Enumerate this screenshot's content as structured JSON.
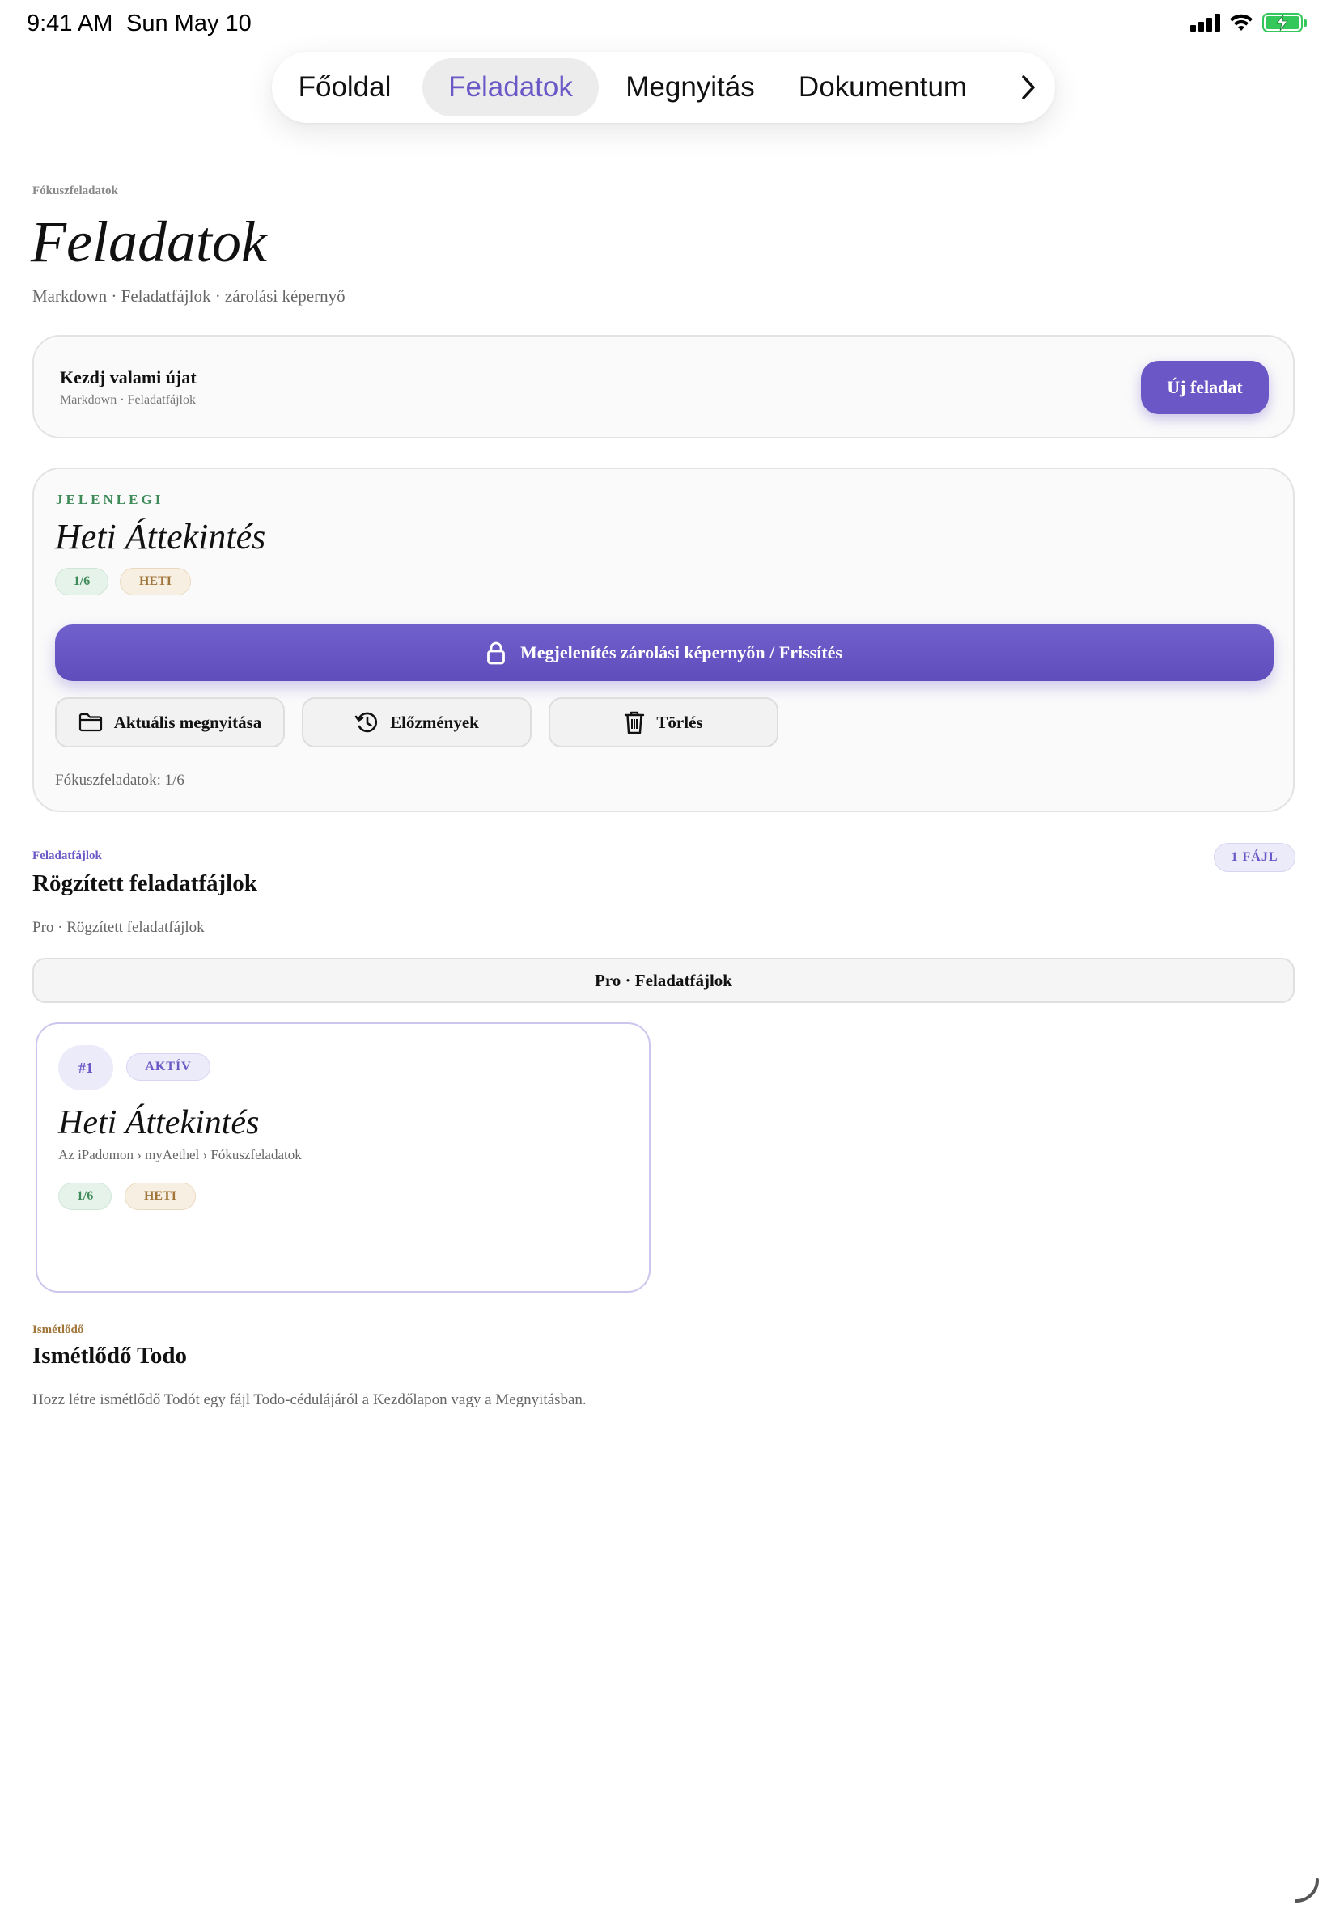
{
  "status_bar": {
    "time": "9:41 AM",
    "date": "Sun May 10"
  },
  "tabs": [
    {
      "label": "Főoldal",
      "active": false
    },
    {
      "label": "Feladatok",
      "active": true
    },
    {
      "label": "Megnyitás",
      "active": false
    },
    {
      "label": "Dokumentum",
      "active": false
    }
  ],
  "header": {
    "kicker": "Fókuszfeladatok",
    "title": "Feladatok",
    "subtitle": "Markdown · Feladatfájlok · zárolási képernyő"
  },
  "new_card": {
    "title": "Kezdj valami újat",
    "subtitle": "Markdown · Feladatfájlok",
    "button": "Új feladat"
  },
  "current": {
    "eyebrow": "JELENLEGI",
    "title": "Heti Áttekintés",
    "progress": "1/6",
    "tag": "HETI",
    "lock_button": "Megjelenítés zárolási képernyőn / Frissítés",
    "open_button": "Aktuális megnyitása",
    "history_button": "Előzmények",
    "delete_button": "Törlés",
    "focus_count": "Fókuszfeladatok: 1/6"
  },
  "files": {
    "kicker": "Feladatfájlok",
    "title": "Rögzített feladatfájlok",
    "subtitle": "Pro · Rögzített feladatfájlok",
    "count_badge": "1 FÁJL",
    "pro_bar": "Pro · Feladatfájlok",
    "items": [
      {
        "number": "#1",
        "status": "AKTÍV",
        "title": "Heti Áttekintés",
        "path": "Az iPadomon › myAethel › Fókuszfeladatok",
        "progress": "1/6",
        "tag": "HETI"
      }
    ]
  },
  "recurring": {
    "kicker": "Ismétlődő",
    "title": "Ismétlődő Todo",
    "description": "Hozz létre ismétlődő Todót egy fájl Todo-cédulájáról a Kezdőlapon vagy a Megnyitásban."
  },
  "colors": {
    "accent": "#6b57c6",
    "green": "#3e8a58",
    "tan": "#a0763a",
    "battery": "#34c759"
  },
  "icons": [
    "cellular-icon",
    "wifi-icon",
    "battery-charging-icon",
    "chevron-right-icon",
    "lock-icon",
    "folder-icon",
    "history-icon",
    "trash-icon"
  ]
}
